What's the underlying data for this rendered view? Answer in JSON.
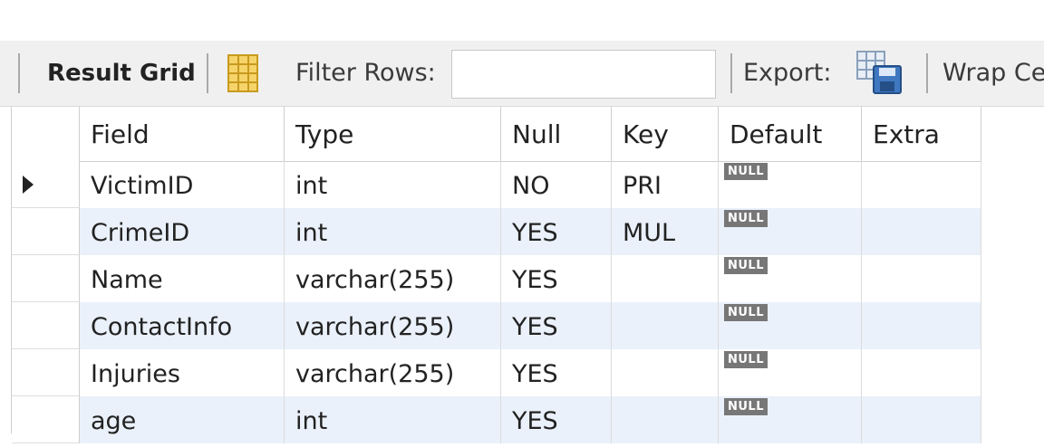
{
  "toolbar": {
    "result_grid_label": "Result Grid",
    "filter_label": "Filter Rows:",
    "filter_value": "",
    "export_label": "Export:",
    "wrap_label": "Wrap Ce"
  },
  "icons": {
    "grid_toggle": "form-grid-icon",
    "export": "export-save-icon",
    "row_pointer": "row-pointer-icon"
  },
  "colors": {
    "alt_row": "#eaf1fa",
    "null_badge": "#777777"
  },
  "columns": [
    "Field",
    "Type",
    "Null",
    "Key",
    "Default",
    "Extra"
  ],
  "rows": [
    {
      "field": "VictimID",
      "type": "int",
      "null": "NO",
      "key": "PRI",
      "default": "NULL",
      "extra": ""
    },
    {
      "field": "CrimeID",
      "type": "int",
      "null": "YES",
      "key": "MUL",
      "default": "NULL",
      "extra": ""
    },
    {
      "field": "Name",
      "type": "varchar(255)",
      "null": "YES",
      "key": "",
      "default": "NULL",
      "extra": ""
    },
    {
      "field": "ContactInfo",
      "type": "varchar(255)",
      "null": "YES",
      "key": "",
      "default": "NULL",
      "extra": ""
    },
    {
      "field": "Injuries",
      "type": "varchar(255)",
      "null": "YES",
      "key": "",
      "default": "NULL",
      "extra": ""
    },
    {
      "field": "age",
      "type": "int",
      "null": "YES",
      "key": "",
      "default": "NULL",
      "extra": ""
    }
  ]
}
